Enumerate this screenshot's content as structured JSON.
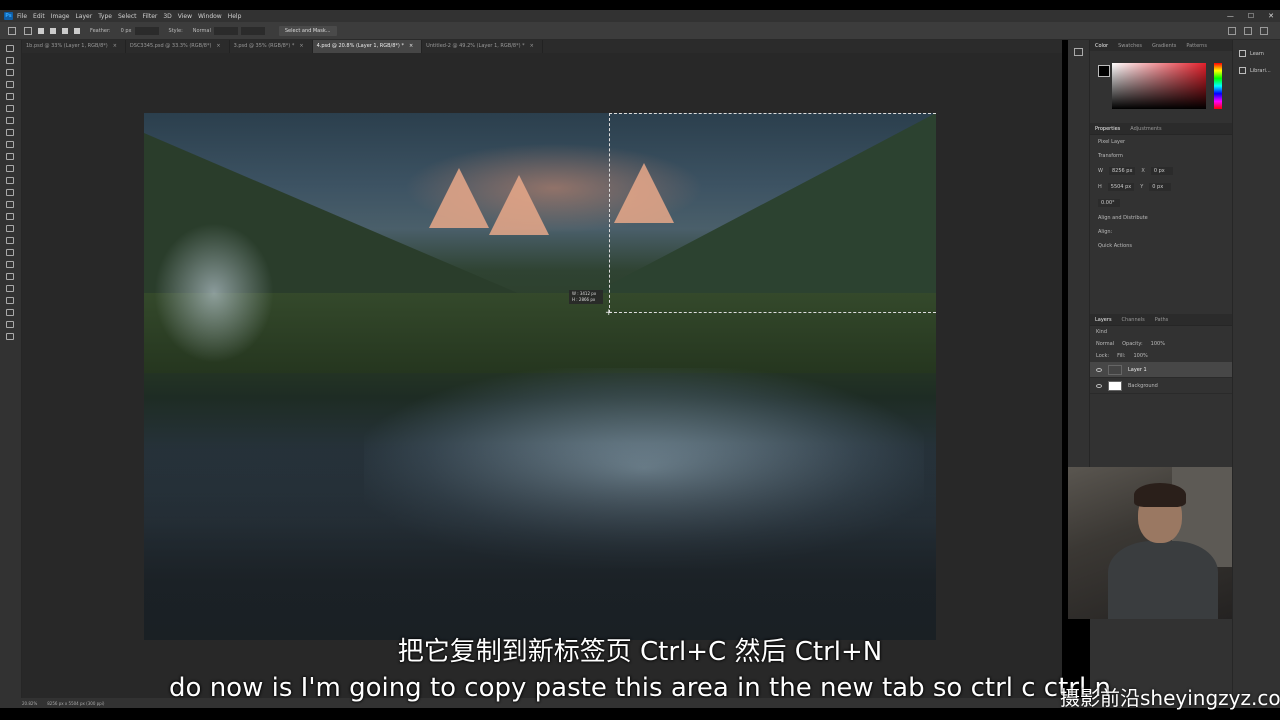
{
  "menu": {
    "logo": "Ps",
    "items": [
      "File",
      "Edit",
      "Image",
      "Layer",
      "Type",
      "Select",
      "Filter",
      "3D",
      "View",
      "Window",
      "Help"
    ],
    "window_controls": [
      "—",
      "☐",
      "✕"
    ]
  },
  "options_bar": {
    "feather_label": "Feather:",
    "feather_value": "0 px",
    "style_label": "Style:",
    "style_value": "Normal",
    "select_mask_label": "Select and Mask..."
  },
  "tabs": [
    {
      "label": "1b.psd @ 33% (Layer 1, RGB/8*)",
      "active": false
    },
    {
      "label": "DSC3345.psd @ 33.3% (RGB/8*)",
      "active": false
    },
    {
      "label": "3.psd @ 35% (RGB/8*) *",
      "active": false
    },
    {
      "label": "4.psd @ 20.8% (Layer 1, RGB/8*) *",
      "active": true
    },
    {
      "label": "Untitled-2 @ 49.2% (Layer 1, RGB/8*) *",
      "active": false
    }
  ],
  "selection_tooltip": {
    "w": "W : 3412 px",
    "h": "H : 2866 px"
  },
  "panels": {
    "color_tabs": [
      "Color",
      "Swatches",
      "Gradients",
      "Patterns"
    ],
    "properties_tabs": [
      "Properties",
      "Adjustments"
    ],
    "properties": {
      "kind": "Pixel Layer",
      "transform_label": "Transform",
      "w": "8256 px",
      "h": "5504 px",
      "x": "0 px",
      "y": "0 px",
      "angle": "0.00°",
      "align_label": "Align and Distribute",
      "align_sub": "Align:",
      "quick_actions_label": "Quick Actions"
    },
    "layers_tabs": [
      "Layers",
      "Channels",
      "Paths"
    ],
    "layers_controls": {
      "kind": "Kind",
      "blend": "Normal",
      "opacity_label": "Opacity:",
      "opacity": "100%",
      "lock_label": "Lock:",
      "fill_label": "Fill:",
      "fill": "100%"
    },
    "layers": [
      {
        "name": "Layer 1",
        "selected": true
      },
      {
        "name": "Background",
        "selected": false
      }
    ]
  },
  "right_strip": {
    "learn": "Learn",
    "libraries": "Librari..."
  },
  "status": {
    "zoom": "20.82%",
    "doc_size": "8256 px x 5504 px (300 ppi)"
  },
  "subtitles": {
    "cn": "把它复制到新标签页 Ctrl+C 然后 Ctrl+N",
    "en": "do now is I'm going to copy paste this area in the new tab so ctrl c ctrl n"
  },
  "watermark": "摄影前沿sheyingzyz.com"
}
